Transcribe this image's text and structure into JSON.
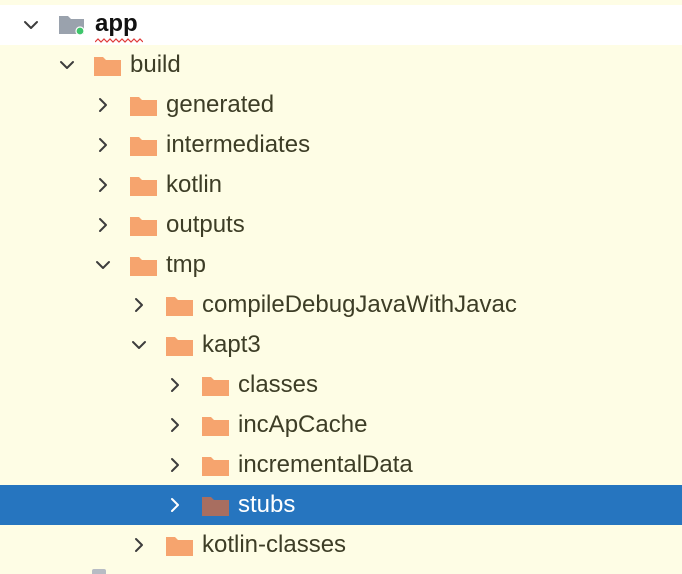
{
  "colors": {
    "background": "#fefde5",
    "selection": "#2675bf",
    "folder": "#f6a46e",
    "folder_selected": "#a86e60",
    "module_folder": "#9aa2ad",
    "module_dot": "#3ec56b",
    "squiggle": "#e03a3a",
    "chevron": "#3d3d3d"
  },
  "tree": {
    "root": {
      "label": "app",
      "icon": "module-folder-icon",
      "expanded": true
    },
    "items": [
      {
        "label": "build",
        "depth": 1,
        "expanded": true,
        "selected": false
      },
      {
        "label": "generated",
        "depth": 2,
        "expanded": false,
        "selected": false
      },
      {
        "label": "intermediates",
        "depth": 2,
        "expanded": false,
        "selected": false
      },
      {
        "label": "kotlin",
        "depth": 2,
        "expanded": false,
        "selected": false
      },
      {
        "label": "outputs",
        "depth": 2,
        "expanded": false,
        "selected": false
      },
      {
        "label": "tmp",
        "depth": 2,
        "expanded": true,
        "selected": false
      },
      {
        "label": "compileDebugJavaWithJavac",
        "depth": 3,
        "expanded": false,
        "selected": false
      },
      {
        "label": "kapt3",
        "depth": 3,
        "expanded": true,
        "selected": false
      },
      {
        "label": "classes",
        "depth": 4,
        "expanded": false,
        "selected": false
      },
      {
        "label": "incApCache",
        "depth": 4,
        "expanded": false,
        "selected": false
      },
      {
        "label": "incrementalData",
        "depth": 4,
        "expanded": false,
        "selected": false
      },
      {
        "label": "stubs",
        "depth": 4,
        "expanded": false,
        "selected": true
      },
      {
        "label": "kotlin-classes",
        "depth": 3,
        "expanded": false,
        "selected": false
      }
    ]
  }
}
